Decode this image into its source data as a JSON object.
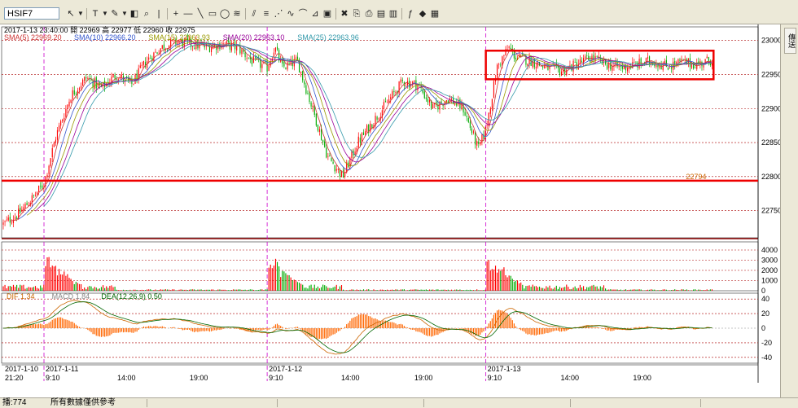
{
  "toolbar": {
    "symbol": "HSIF7",
    "tools": [
      {
        "name": "arrow-tool-icon",
        "glyph": "↖"
      },
      {
        "name": "text-tool-icon",
        "glyph": "T"
      },
      {
        "name": "pen-tool-icon",
        "glyph": "✎"
      },
      {
        "name": "palette-tool-icon",
        "glyph": "◧"
      },
      {
        "name": "zoom-tool-icon",
        "glyph": "⌕"
      },
      {
        "name": "line-tool-icon",
        "glyph": "|"
      },
      {
        "name": "crosshair-tool-icon",
        "glyph": "+"
      },
      {
        "name": "hline-tool-icon",
        "glyph": "—"
      },
      {
        "name": "diagonal-line-tool-icon",
        "glyph": "╲"
      },
      {
        "name": "rectangle-tool-icon",
        "glyph": "▭"
      },
      {
        "name": "ellipse-tool-icon",
        "glyph": "◯"
      },
      {
        "name": "channel-tool-icon",
        "glyph": "≋"
      },
      {
        "name": "parallel-tool-icon",
        "glyph": "⫽"
      },
      {
        "name": "fibonacci-tool-icon",
        "glyph": "≡"
      },
      {
        "name": "fan-tool-icon",
        "glyph": "⋰"
      },
      {
        "name": "cycle-tool-icon",
        "glyph": "∿"
      },
      {
        "name": "arc-tool-icon",
        "glyph": "⌒"
      },
      {
        "name": "measure-tool-icon",
        "glyph": "⊿"
      },
      {
        "name": "box-tool-icon",
        "glyph": "▣"
      },
      {
        "name": "delete-tool-icon",
        "glyph": "✖"
      },
      {
        "name": "copy-tool-icon",
        "glyph": "⎘"
      },
      {
        "name": "print-tool-icon",
        "glyph": "⎙"
      },
      {
        "name": "save-tool-icon",
        "glyph": "▤"
      },
      {
        "name": "export-tool-icon",
        "glyph": "▥"
      },
      {
        "name": "indicator-tool-icon",
        "glyph": "ƒ"
      },
      {
        "name": "alert-tool-icon",
        "glyph": "◆"
      },
      {
        "name": "settings-tool-icon",
        "glyph": "▦"
      }
    ]
  },
  "sidebar": {
    "label": "傳送"
  },
  "status": {
    "left": "播:774",
    "mid": "所有數據僅供參考"
  },
  "colors": {
    "up": "#ff0000",
    "down": "#00aa00",
    "sma5": "#cc3333",
    "sma10": "#3355cc",
    "sma15": "#999900",
    "sma20": "#990099",
    "sma25": "#3399aa",
    "dif": "#cc6600",
    "dea": "#006600",
    "macd": "#888888",
    "hist": "#ff6600"
  },
  "chart_data": {
    "type": "candlestick",
    "title": "HSIF7",
    "info_line": "2017-1-13 23:40:00 開 22969 高 22977 低 22960 收 22975",
    "sma_labels": [
      {
        "text": "SMA(5) 22969.20",
        "color": "#cc3333"
      },
      {
        "text": "SMA(10) 22966.20",
        "color": "#3355cc"
      },
      {
        "text": "SMA(15) 22963.93",
        "color": "#999900"
      },
      {
        "text": "SMA(20) 22963.10",
        "color": "#990099"
      },
      {
        "text": "SMA(25) 22963.96",
        "color": "#3399aa"
      }
    ],
    "price_axis": {
      "ticks": [
        23000,
        22950,
        22900,
        22850,
        22800,
        22750
      ],
      "ylim": [
        22710,
        23020
      ]
    },
    "support_line": {
      "label": "22794",
      "value": 22794
    },
    "volume_axis": {
      "ticks": [
        4000,
        3000,
        2000,
        1000,
        0
      ],
      "ylim": [
        0,
        4800
      ]
    },
    "macd_labels": [
      {
        "text": "DIF 1.34",
        "color": "#cc6600"
      },
      {
        "text": "MACD 1.84",
        "color": "#888888"
      },
      {
        "text": "DEA(12,26,9) 0.50",
        "color": "#006600"
      }
    ],
    "macd_axis": {
      "ticks": [
        40,
        20,
        0,
        -20,
        -40
      ],
      "ylim": [
        -48,
        48
      ]
    },
    "x_labels": [
      {
        "date": "2017-1-10",
        "time": "21:20",
        "t": 0
      },
      {
        "date": "2017-1-11",
        "time": "9:10",
        "t": 0.054
      },
      {
        "date": "",
        "time": "14:00",
        "t": 0.149
      },
      {
        "date": "",
        "time": "19:00",
        "t": 0.245
      },
      {
        "date": "2017-1-12",
        "time": "9:10",
        "t": 0.35
      },
      {
        "date": "",
        "time": "14:00",
        "t": 0.446
      },
      {
        "date": "",
        "time": "19:00",
        "t": 0.543
      },
      {
        "date": "2017-1-13",
        "time": "9:10",
        "t": 0.64
      },
      {
        "date": "",
        "time": "14:00",
        "t": 0.737
      },
      {
        "date": "",
        "time": "19:00",
        "t": 0.833
      }
    ],
    "session_breaks": [
      0.054,
      0.35,
      0.64
    ],
    "path_keypoints": [
      [
        0,
        22730
      ],
      [
        0.02,
        22745
      ],
      [
        0.04,
        22770
      ],
      [
        0.054,
        22790
      ],
      [
        0.07,
        22860
      ],
      [
        0.09,
        22920
      ],
      [
        0.11,
        22945
      ],
      [
        0.13,
        22930
      ],
      [
        0.15,
        22950
      ],
      [
        0.17,
        22935
      ],
      [
        0.19,
        22970
      ],
      [
        0.21,
        22990
      ],
      [
        0.23,
        22998
      ],
      [
        0.25,
        22995
      ],
      [
        0.27,
        22990
      ],
      [
        0.29,
        22995
      ],
      [
        0.31,
        22990
      ],
      [
        0.33,
        22970
      ],
      [
        0.35,
        22960
      ],
      [
        0.36,
        22990
      ],
      [
        0.37,
        22960
      ],
      [
        0.39,
        22970
      ],
      [
        0.41,
        22900
      ],
      [
        0.43,
        22830
      ],
      [
        0.45,
        22800
      ],
      [
        0.47,
        22850
      ],
      [
        0.49,
        22880
      ],
      [
        0.51,
        22910
      ],
      [
        0.53,
        22940
      ],
      [
        0.55,
        22935
      ],
      [
        0.57,
        22900
      ],
      [
        0.59,
        22915
      ],
      [
        0.61,
        22900
      ],
      [
        0.63,
        22840
      ],
      [
        0.64,
        22870
      ],
      [
        0.655,
        22960
      ],
      [
        0.67,
        22990
      ],
      [
        0.68,
        22975
      ],
      [
        0.7,
        22970
      ],
      [
        0.72,
        22960
      ],
      [
        0.74,
        22955
      ],
      [
        0.76,
        22965
      ],
      [
        0.78,
        22975
      ],
      [
        0.8,
        22965
      ],
      [
        0.82,
        22960
      ],
      [
        0.84,
        22965
      ],
      [
        0.86,
        22970
      ],
      [
        0.88,
        22962
      ],
      [
        0.9,
        22968
      ],
      [
        0.92,
        22965
      ],
      [
        0.94,
        22972
      ]
    ],
    "highlight_box": {
      "t0": 0.64,
      "t1": 0.942,
      "p_high": 22985,
      "p_low": 22943
    }
  }
}
